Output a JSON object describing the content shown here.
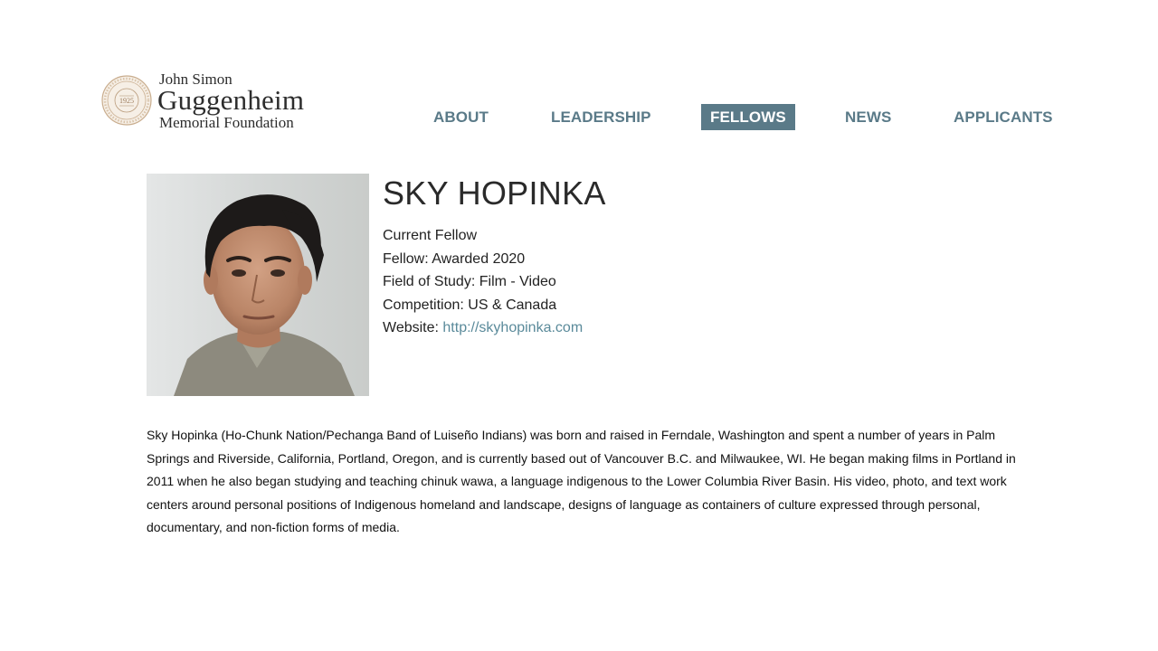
{
  "logo": {
    "line1": "John Simon",
    "line2": "Guggenheim",
    "line3": "Memorial Foundation",
    "seal_year": "1925"
  },
  "nav": {
    "items": [
      {
        "label": "ABOUT",
        "active": false
      },
      {
        "label": "LEADERSHIP",
        "active": false
      },
      {
        "label": "FELLOWS",
        "active": true
      },
      {
        "label": "NEWS",
        "active": false
      },
      {
        "label": "APPLICANTS",
        "active": false
      }
    ]
  },
  "fellow": {
    "name": "SKY HOPINKA",
    "status": "Current Fellow",
    "awarded_label": "Fellow: Awarded",
    "awarded_year": "2020",
    "field_label": "Field of Study:",
    "field": "Film - Video",
    "competition_label": "Competition:",
    "competition": "US & Canada",
    "website_label": "Website:",
    "website": "http://skyhopinka.com",
    "bio": "Sky Hopinka (Ho-Chunk Nation/Pechanga Band of Luiseño Indians) was born and raised in Ferndale, Washington and spent a number of years in Palm Springs and Riverside, California, Portland, Oregon, and is currently based out of Vancouver B.C. and Milwaukee, WI.  He began making films in Portland in 2011 when he also began studying and teaching chinuk wawa, a language indigenous to the Lower Columbia River Basin. His video, photo, and text work centers around personal positions of Indigenous homeland and landscape, designs of language as containers of culture expressed through personal, documentary, and non-fiction forms of media."
  },
  "colors": {
    "nav_accent": "#5a7a88",
    "link": "#5a8a9a",
    "text": "#222222"
  }
}
